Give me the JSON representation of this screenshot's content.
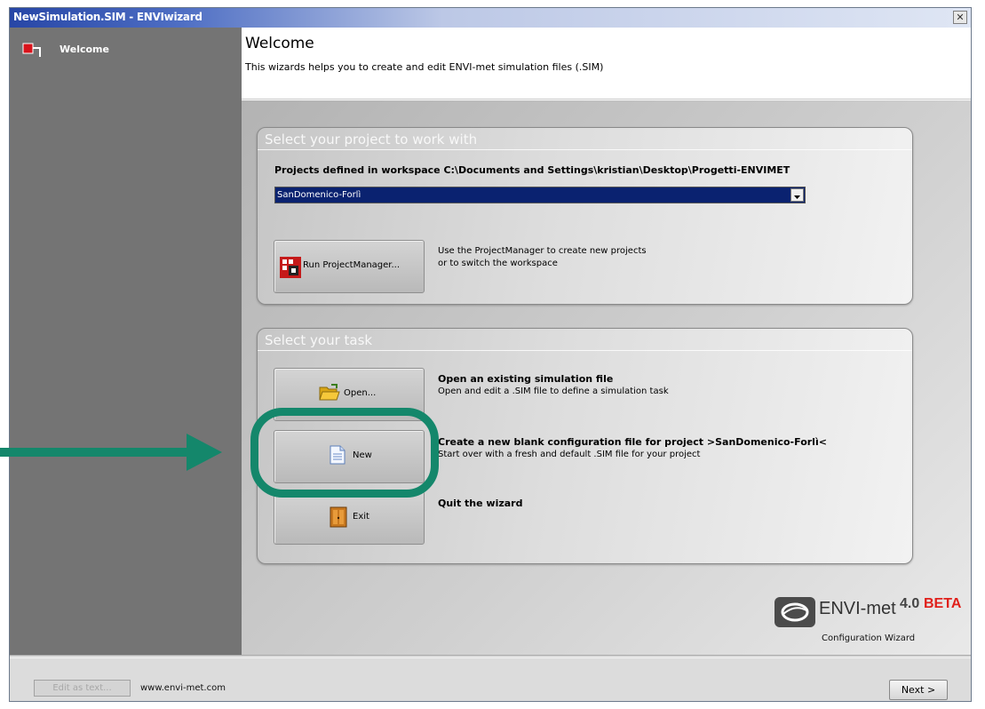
{
  "window": {
    "title": "NewSimulation.SIM - ENVIwizard",
    "close_glyph": "✕",
    "title_gradient": [
      "#2746a6",
      "#dfe6f4"
    ]
  },
  "sidebar": {
    "items": [
      {
        "label": "Welcome",
        "icon": "red-step-icon",
        "active": true
      }
    ]
  },
  "header": {
    "title": "Welcome",
    "subtitle": "This wizards helps you to create and edit ENVI-met simulation files (.SIM)"
  },
  "project_panel": {
    "title": "Select your project to work with",
    "workspace_label": "Projects defined in workspace C:\\Documents and Settings\\kristian\\Desktop\\Progetti-ENVIMET",
    "project_select": {
      "value": "SanDomenico-Forlì",
      "icon": "chevron-down-icon"
    },
    "project_manager_button": {
      "label": "Run ProjectManager...",
      "icon": "project-manager-icon"
    },
    "project_manager_help": [
      "Use the ProjectManager to create new projects",
      "or to switch the workspace"
    ]
  },
  "task_panel": {
    "title": "Select your task",
    "tasks": [
      {
        "button_label": "Open...",
        "icon": "folder-open-icon",
        "heading": "Open an existing simulation file",
        "description": "Open and edit a .SIM file to define a simulation task"
      },
      {
        "button_label": "New",
        "icon": "new-file-icon",
        "heading": "Create a new blank configuration file for project >SanDomenico-Forlì<",
        "description": "Start over with a fresh and default .SIM file for your project"
      },
      {
        "button_label": "Exit",
        "icon": "exit-door-icon",
        "heading": "Quit the wizard",
        "description": ""
      }
    ]
  },
  "branding": {
    "product": "ENVI-met",
    "version": "4.0",
    "tag": "BETA",
    "tag_color": "#e0201b",
    "caption": "Configuration Wizard"
  },
  "footer": {
    "edit_as_text_label": "Edit as text...",
    "url": "www.envi-met.com",
    "next_label": "Next >"
  },
  "annotation": {
    "color": "#14876b",
    "target": "New"
  }
}
